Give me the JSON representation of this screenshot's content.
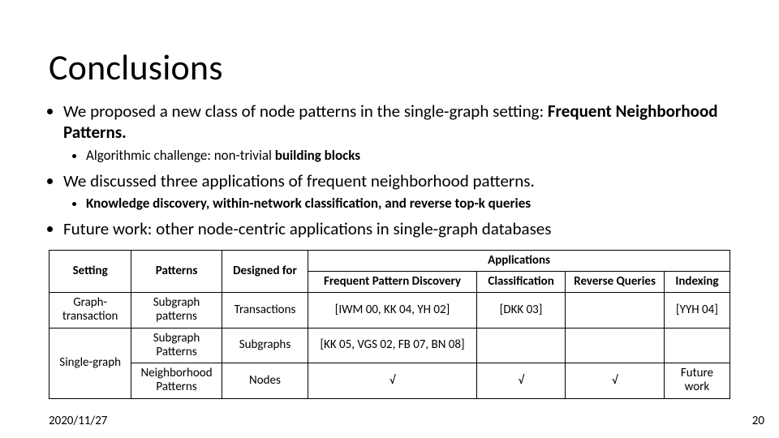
{
  "title": "Conclusions",
  "bul": {
    "b1a": "We proposed a new class of node patterns in the single-graph setting: ",
    "b1b": "Frequent Neighborhood Patterns.",
    "b1_sub_a": "Algorithmic challenge: non-trivial ",
    "b1_sub_b": "building blocks",
    "b2": "We discussed three applications of frequent neighborhood patterns.",
    "b2_sub_a": "Knowledge discovery, within-network classification, and reverse top-k queries",
    "b3": "Future work: other node-centric applications in single-graph databases"
  },
  "tbl": {
    "h_setting": "Setting",
    "h_patterns": "Patterns",
    "h_designed": "Designed for",
    "h_apps": "Applications",
    "h_fpd": "Frequent Pattern Discovery",
    "h_class": "Classification",
    "h_rev": "Reverse Queries",
    "h_idx": "Indexing",
    "r1_setting": "Graph-transaction",
    "r1_patterns": "Subgraph patterns",
    "r1_designed": "Transactions",
    "r1_fpd": "[IWM 00, KK 04, YH 02]",
    "r1_class": "[DKK 03]",
    "r1_rev": "",
    "r1_idx": "[YYH 04]",
    "r23_setting": "Single-graph",
    "r2_patterns": "Subgraph Patterns",
    "r2_designed": "Subgraphs",
    "r2_fpd": "[KK 05, VGS 02, FB 07, BN 08]",
    "r2_class": "",
    "r2_rev": "",
    "r2_idx": "",
    "r3_patterns": "Neighborhood Patterns",
    "r3_designed": "Nodes",
    "r3_fpd": "√",
    "r3_class": "√",
    "r3_rev": "√",
    "r3_idx": "Future work"
  },
  "date": "2020/11/27",
  "page": "20"
}
